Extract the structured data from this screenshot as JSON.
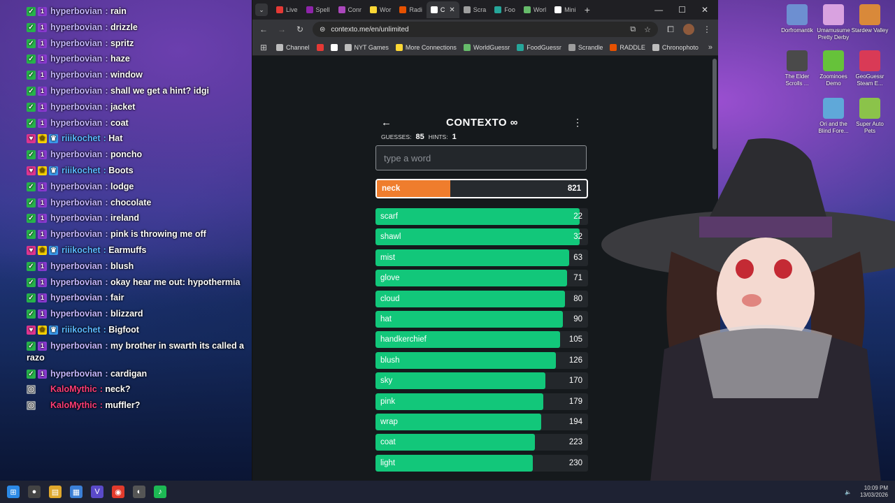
{
  "chat": [
    {
      "user": "hyperbovian",
      "text": "rain",
      "kind": "hyper"
    },
    {
      "user": "hyperbovian",
      "text": "drizzle",
      "kind": "hyper"
    },
    {
      "user": "hyperbovian",
      "text": "spritz",
      "kind": "hyper"
    },
    {
      "user": "hyperbovian",
      "text": "haze",
      "kind": "hyper"
    },
    {
      "user": "hyperbovian",
      "text": "window",
      "kind": "hyper"
    },
    {
      "user": "hyperbovian",
      "text": "shall we get a hint? idgi",
      "kind": "hyper"
    },
    {
      "user": "hyperbovian",
      "text": "jacket",
      "kind": "hyper"
    },
    {
      "user": "hyperbovian",
      "text": "coat",
      "kind": "hyper"
    },
    {
      "user": "riiikochet",
      "text": "Hat",
      "kind": "riiko"
    },
    {
      "user": "hyperbovian",
      "text": "poncho",
      "kind": "hyper"
    },
    {
      "user": "riiikochet",
      "text": "Boots",
      "kind": "riiko"
    },
    {
      "user": "hyperbovian",
      "text": "lodge",
      "kind": "hyper"
    },
    {
      "user": "hyperbovian",
      "text": "chocolate",
      "kind": "hyper"
    },
    {
      "user": "hyperbovian",
      "text": "ireland",
      "kind": "hyper"
    },
    {
      "user": "hyperbovian",
      "text": "pink is throwing me off",
      "kind": "hyper"
    },
    {
      "user": "riiikochet",
      "text": "Earmuffs",
      "kind": "riiko"
    },
    {
      "user": "hyperbovian",
      "text": "blush",
      "kind": "hyper"
    },
    {
      "user": "hyperbovian",
      "text": "okay hear me out: hypothermia",
      "kind": "hyper"
    },
    {
      "user": "hyperbovian",
      "text": "fair",
      "kind": "hyper"
    },
    {
      "user": "hyperbovian",
      "text": "blizzard",
      "kind": "hyper"
    },
    {
      "user": "riiikochet",
      "text": "Bigfoot",
      "kind": "riiko"
    },
    {
      "user": "hyperbovian",
      "text": "my brother in swarth its called a razo",
      "kind": "hyper"
    },
    {
      "user": "hyperbovian",
      "text": "cardigan",
      "kind": "hyper"
    },
    {
      "user": "KaloMythic",
      "text": "neck?",
      "kind": "kalo"
    },
    {
      "user": "KaloMythic",
      "text": "muffler?",
      "kind": "kalo"
    }
  ],
  "browser": {
    "tabs": [
      {
        "label": "Live",
        "color": "#e53935"
      },
      {
        "label": "Spell",
        "color": "#8e24aa"
      },
      {
        "label": "Conr",
        "color": "#ab47bc"
      },
      {
        "label": "Wor",
        "color": "#fdd835"
      },
      {
        "label": "Radi",
        "color": "#e65100"
      },
      {
        "label": "C",
        "color": "#ffffff",
        "active": true
      },
      {
        "label": "Scra",
        "color": "#9e9e9e"
      },
      {
        "label": "Foo",
        "color": "#26a69a"
      },
      {
        "label": "Worl",
        "color": "#66bb6a"
      },
      {
        "label": "Mini",
        "color": "#ffffff"
      }
    ],
    "url": "contexto.me/en/unlimited",
    "bookmarks": [
      {
        "label": "Channel",
        "color": "#bdbdbd"
      },
      {
        "label": "",
        "color": "#e53935"
      },
      {
        "label": "",
        "color": "#ffffff"
      },
      {
        "label": "NYT Games",
        "color": "#bdbdbd"
      },
      {
        "label": "More Connections",
        "color": "#fdd835"
      },
      {
        "label": "WorldGuessr",
        "color": "#66bb6a"
      },
      {
        "label": "FoodGuessr",
        "color": "#26a69a"
      },
      {
        "label": "Scrandle",
        "color": "#9e9e9e"
      },
      {
        "label": "RADDLE",
        "color": "#e65100"
      },
      {
        "label": "Chronophoto",
        "color": "#bdbdbd"
      }
    ]
  },
  "contexto": {
    "title": "CONTEXTO ∞",
    "guesses_label": "GUESSES:",
    "guesses_value": "85",
    "hints_label": "HINTS:",
    "hints_value": "1",
    "input_placeholder": "type a word",
    "last_guess": {
      "word": "neck",
      "rank": "821",
      "fill": 0.35
    },
    "guesses": [
      {
        "word": "scarf",
        "rank": "22",
        "fill": 0.96
      },
      {
        "word": "shawl",
        "rank": "32",
        "fill": 0.96
      },
      {
        "word": "mist",
        "rank": "63",
        "fill": 0.91
      },
      {
        "word": "glove",
        "rank": "71",
        "fill": 0.9
      },
      {
        "word": "cloud",
        "rank": "80",
        "fill": 0.89
      },
      {
        "word": "hat",
        "rank": "90",
        "fill": 0.88
      },
      {
        "word": "handkerchief",
        "rank": "105",
        "fill": 0.87
      },
      {
        "word": "blush",
        "rank": "126",
        "fill": 0.85
      },
      {
        "word": "sky",
        "rank": "170",
        "fill": 0.8
      },
      {
        "word": "pink",
        "rank": "179",
        "fill": 0.79
      },
      {
        "word": "wrap",
        "rank": "194",
        "fill": 0.78
      },
      {
        "word": "coat",
        "rank": "223",
        "fill": 0.75
      },
      {
        "word": "light",
        "rank": "230",
        "fill": 0.74
      }
    ]
  },
  "desktop_icons": [
    {
      "label": "Dorfromantik",
      "color": "#6d8fd1"
    },
    {
      "label": "Umamusume Pretty Derby",
      "color": "#d9a2e0"
    },
    {
      "label": "Stardew Valley",
      "color": "#d9893a"
    },
    {
      "label": "The Elder Scrolls ...",
      "color": "#4a4a4a"
    },
    {
      "label": "Zoominoes Demo",
      "color": "#66c23a"
    },
    {
      "label": "GeoGuessr Steam E...",
      "color": "#d93a56"
    },
    {
      "label": "Ori and the Blind Fore...",
      "color": "#5fa8d9"
    },
    {
      "label": "Super Auto Pets",
      "color": "#8bc34a"
    }
  ],
  "taskbar": {
    "time": "10:09 PM",
    "date": "13/03/2026"
  }
}
